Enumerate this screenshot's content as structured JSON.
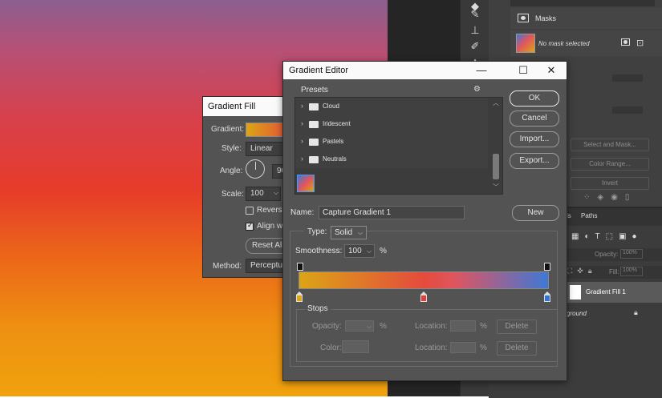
{
  "gradient_fill": {
    "title": "Gradient Fill",
    "gradient_label": "Gradient:",
    "style_label": "Style:",
    "style_value": "Linear",
    "angle_label": "Angle:",
    "angle_value": "90",
    "scale_label": "Scale:",
    "scale_value": "100",
    "reverse_label": "Reverse",
    "align_label": "Align wi",
    "reset_label": "Reset Alic",
    "method_label": "Method:",
    "method_value": "Perceptua"
  },
  "gradient_editor": {
    "title": "Gradient Editor",
    "presets_label": "Presets",
    "folders": [
      "Cloud",
      "Iridescent",
      "Pastels",
      "Neutrals"
    ],
    "buttons": {
      "ok": "OK",
      "cancel": "Cancel",
      "import": "Import...",
      "export": "Export...",
      "new": "New"
    },
    "name_label": "Name:",
    "name_value": "Capture Gradient 1",
    "type_label": "Type:",
    "type_value": "Solid",
    "smoothness_label": "Smoothness:",
    "smoothness_value": "100",
    "percent": "%",
    "stops": {
      "label": "Stops",
      "opacity_label": "Opacity:",
      "color_label": "Color:",
      "location_label": "Location:",
      "delete_label": "Delete"
    },
    "gradient_colors": [
      "#dba515",
      "#e44b3c",
      "#e0555e",
      "#3f78d6"
    ],
    "stop_colors": [
      "#dba515",
      "#e33d35",
      "#2d76d6"
    ]
  },
  "properties_panel": {
    "masks_label": "Masks",
    "no_mask": "No mask selected",
    "select_mask": "Select and Mask...",
    "color_range": "Color Range...",
    "invert": "Invert"
  },
  "layers_panel": {
    "paths_tab": "Paths",
    "opacity_label": "Opacity:",
    "opacity_value": "100%",
    "fill_label": "Fill:",
    "fill_value": "100%",
    "layer_gradient": "Gradient Fill 1",
    "layer_bg": "kground"
  }
}
